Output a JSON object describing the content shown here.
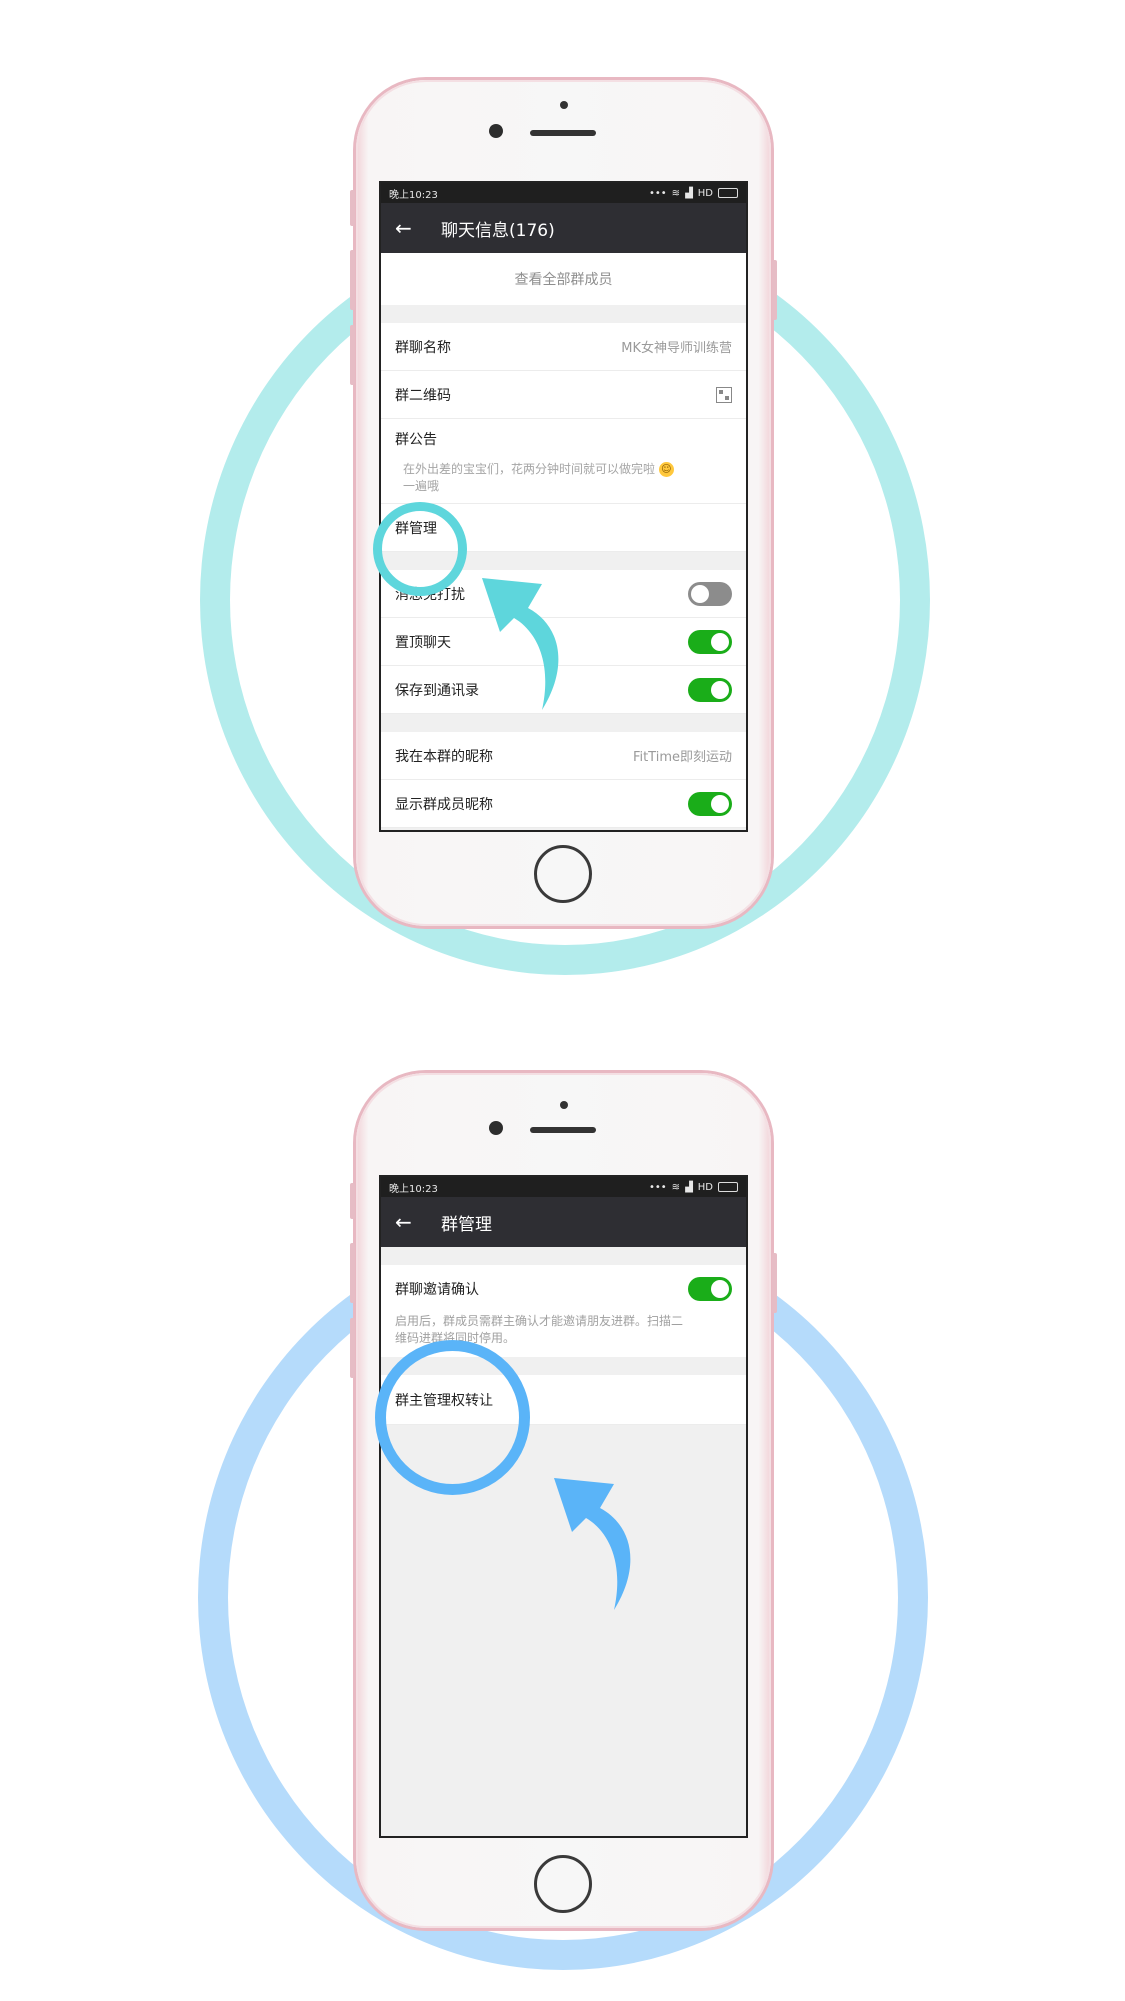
{
  "colors": {
    "ring_top": "#b3ecec",
    "ring_bottom": "#b5dbfb",
    "accent_teal": "#5ed6dc",
    "accent_blue": "#5ab4f8",
    "toggle_on": "#1aad19",
    "toggle_off": "#8c8c8c",
    "titlebar": "#2e2e33"
  },
  "screen1": {
    "status": {
      "time": "晚上10:23",
      "signal": "... ",
      "hd": "HD"
    },
    "header": {
      "back_icon": "back-arrow-icon",
      "title": "聊天信息(176)"
    },
    "view_all_members": "查看全部群成员",
    "group_name": {
      "label": "群聊名称",
      "value": "MK女神导师训练营"
    },
    "group_qr": {
      "label": "群二维码",
      "icon": "qr-code-icon"
    },
    "announcement": {
      "label": "群公告",
      "line1": "在外出差的宝宝们，花两分钟时间就可以做完啦",
      "line2": "一遍哦"
    },
    "group_manage": {
      "label": "群管理"
    },
    "mute": {
      "label": "消息免打扰",
      "on": false
    },
    "pin": {
      "label": "置顶聊天",
      "on": true
    },
    "save_contacts": {
      "label": "保存到通讯录",
      "on": true
    },
    "my_nickname": {
      "label": "我在本群的昵称",
      "value": "FitTime即刻运动"
    },
    "show_nicknames": {
      "label": "显示群成员昵称",
      "on": true
    }
  },
  "screen2": {
    "status": {
      "time": "晚上10:23",
      "hd": "HD"
    },
    "header": {
      "back_icon": "back-arrow-icon",
      "title": "群管理"
    },
    "invite_confirm": {
      "label": "群聊邀请确认",
      "on": true,
      "desc_line1": "启用后，群成员需群主确认才能邀请朋友进群。扫描二",
      "desc_line2": "维码进群将同时停用。"
    },
    "transfer_owner": {
      "label": "群主管理权转让"
    }
  }
}
